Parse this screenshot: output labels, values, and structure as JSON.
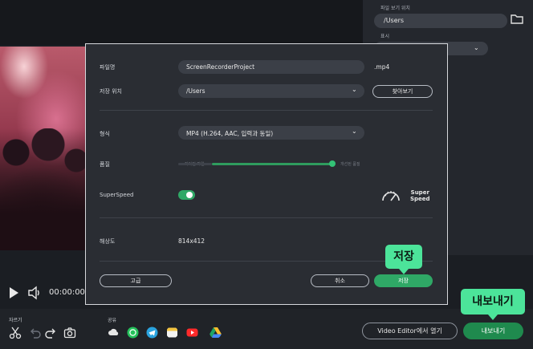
{
  "player": {
    "time": "00:00:00"
  },
  "right_panel": {
    "folder_label": "파일 보기 위치",
    "folder_value": "/Users",
    "display_label": "표시"
  },
  "dialog": {
    "filename_label": "파일명",
    "filename_value": "ScreenRecorderProject",
    "extension": ".mp4",
    "location_label": "저장 위치",
    "location_value": "/Users",
    "browse_label": "찾아보기",
    "format_label": "형식",
    "format_value": "MP4 (H.264, AAC, 입력과 동일)",
    "quality_label": "품질",
    "quality_min_label": "작아진 파일",
    "quality_max_label": "개선된 품질",
    "quality_level": 0.92,
    "superspeed_label": "SuperSpeed",
    "superspeed_on": true,
    "superspeed_badge_line1": "Super",
    "superspeed_badge_line2": "Speed",
    "resolution_label": "해상도",
    "resolution_value": "814x412",
    "advanced_label": "고급",
    "cancel_label": "취소",
    "save_label": "저장"
  },
  "bottom_bar": {
    "trim_label": "자르기",
    "share_label": "공유",
    "editor_button": "Video Editor에서 열기",
    "export_button": "내보내기",
    "tools": [
      "scissors-icon",
      "undo-icon",
      "redo-icon",
      "camera-icon"
    ],
    "share_targets": [
      "cloud-icon",
      "whatsapp-icon",
      "telegram-icon",
      "notes-icon",
      "youtube-icon",
      "google-drive-icon"
    ]
  },
  "callouts": {
    "save": "저장",
    "export": "내보내기"
  },
  "colors": {
    "accent": "#2fa866",
    "callout": "#4ce49a",
    "panel": "#2a2d33"
  }
}
